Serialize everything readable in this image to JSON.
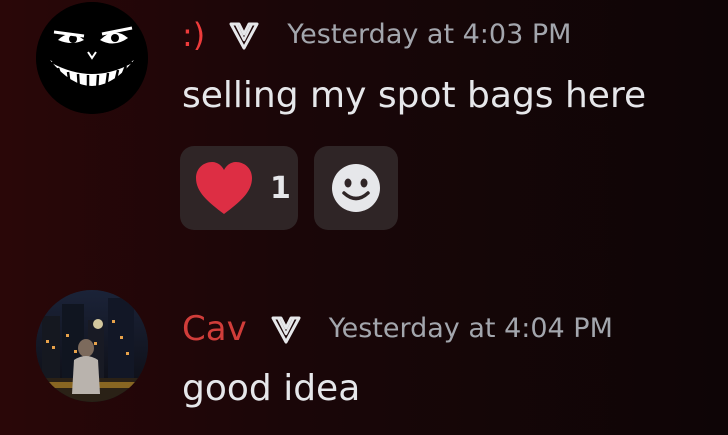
{
  "messages": [
    {
      "username": ":)",
      "timestamp": "Yesterday at 4:03 PM",
      "content": "selling my spot bags here",
      "reactions": [
        {
          "icon": "heart-icon",
          "count": "1"
        }
      ],
      "colors": {
        "username": "#ee3b3b"
      }
    },
    {
      "username": "Cav",
      "timestamp": "Yesterday at 4:04 PM",
      "content": "good idea",
      "colors": {
        "username": "#d13d3a"
      }
    }
  ],
  "icons": {
    "badge": "v-badge-icon",
    "add_reaction": "smiley-add-reaction-icon"
  },
  "colors": {
    "background": "#1a0608",
    "reaction_bg": "#2f2526",
    "heart": "#dd2e44",
    "timestamp": "#a3a6ad"
  }
}
